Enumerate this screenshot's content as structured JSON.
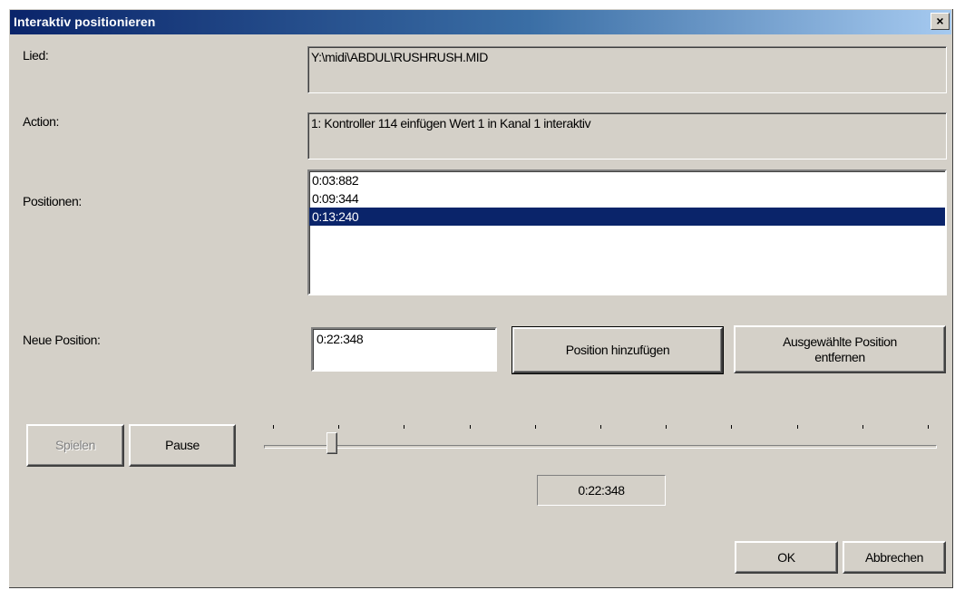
{
  "window": {
    "title": "Interaktiv positionieren",
    "close_glyph": "×"
  },
  "labels": {
    "song": "Lied:",
    "action": "Action:",
    "positions": "Positionen:",
    "new_position": "Neue Position:"
  },
  "song_value": "Y:\\midi\\ABDUL\\RUSHRUSH.MID",
  "action_value": "1: Kontroller 114 einfügen Wert 1 in Kanal 1 interaktiv",
  "positions": [
    {
      "value": "0:03:882",
      "selected": false
    },
    {
      "value": "0:09:344",
      "selected": false
    },
    {
      "value": "0:13:240",
      "selected": true
    }
  ],
  "new_position_value": "0:22:348",
  "buttons": {
    "add_position": "Position hinzufügen",
    "remove_position": "Ausgewählte Position entfernen",
    "play": "Spielen",
    "pause": "Pause",
    "ok": "OK",
    "cancel": "Abbrechen"
  },
  "slider": {
    "position_fraction": 0.09,
    "tick_count": 11
  },
  "time_display": "0:22:348",
  "colors": {
    "dialog_face": "#d4d0c8",
    "title_active": "#0a246a",
    "selection": "#0a246a"
  }
}
